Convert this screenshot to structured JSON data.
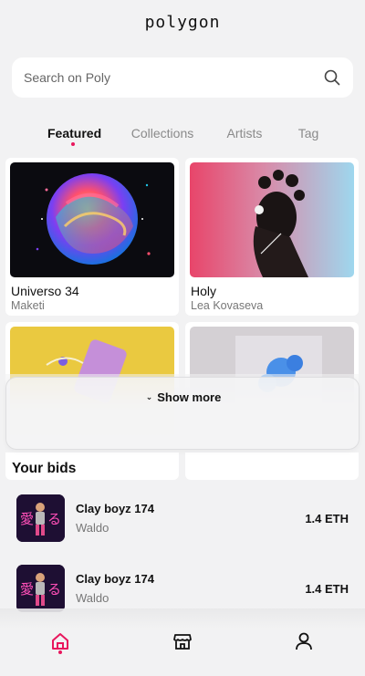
{
  "app": {
    "logo": "polygon"
  },
  "search": {
    "placeholder": "Search on Poly",
    "icon": "search-icon"
  },
  "tabs": [
    {
      "label": "Featured",
      "active": true
    },
    {
      "label": "Collections",
      "active": false
    },
    {
      "label": "Artists",
      "active": false
    },
    {
      "label": "Tag",
      "active": false
    }
  ],
  "featured": [
    {
      "title": "Universo 34",
      "artist": "Maketi"
    },
    {
      "title": "Holy",
      "artist": "Lea Kovaseva"
    },
    {
      "title": "",
      "artist": ""
    },
    {
      "title": "",
      "artist": ""
    }
  ],
  "show_more": {
    "label": "Show more",
    "icon": "chevron-down-icon"
  },
  "bids": {
    "title": "Your bids",
    "items": [
      {
        "name": "Clay boyz 174",
        "owner": "Waldo",
        "price": "1.4 ETH"
      },
      {
        "name": "Clay boyz 174",
        "owner": "Waldo",
        "price": "1.4 ETH"
      }
    ]
  },
  "nav": {
    "items": [
      "home-icon",
      "store-icon",
      "profile-icon"
    ],
    "active": "home-icon"
  },
  "colors": {
    "accent": "#e8175d",
    "background": "#f2f2f3"
  }
}
